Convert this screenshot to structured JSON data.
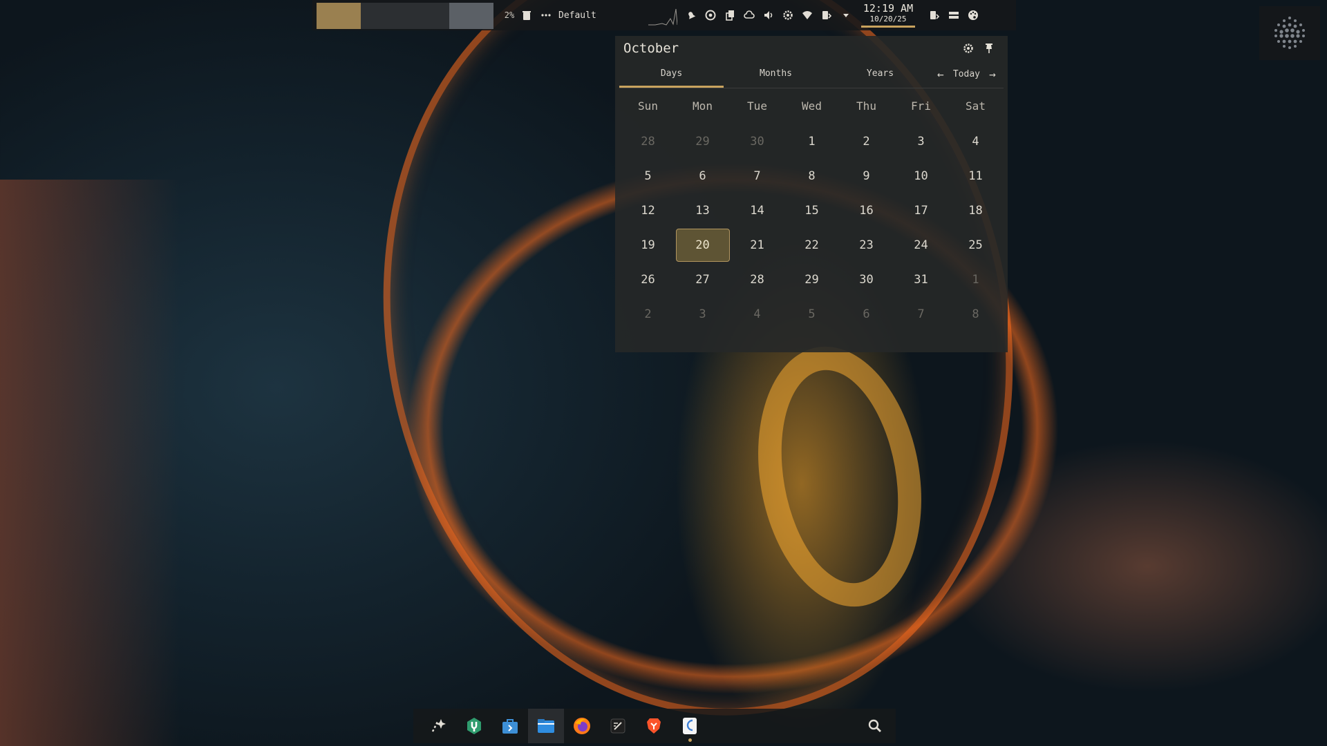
{
  "topbar": {
    "workspaces": [
      {
        "id": 1,
        "active": true
      },
      {
        "id": 2,
        "active": false
      },
      {
        "id": 3,
        "active": false
      },
      {
        "id": 4,
        "active": false
      }
    ],
    "cpu_usage": "2%",
    "power_profile": "Default",
    "clock": {
      "time": "12:19 AM",
      "date": "10/20/25"
    },
    "tray_icons": [
      "notification-bell-icon",
      "obs-icon",
      "clipboard-icon",
      "cloud-sync-icon",
      "volume-icon",
      "settings-gear-icon",
      "wifi-icon",
      "bluetooth-battery-icon",
      "chevron-down-icon"
    ],
    "right_icons": [
      "power-menu-icon",
      "wallpaper-icon",
      "theme-palette-icon"
    ]
  },
  "calendar": {
    "month_title": "October",
    "tabs": [
      "Days",
      "Months",
      "Years"
    ],
    "active_tab": "Days",
    "today_label": "Today",
    "weekdays": [
      "Sun",
      "Mon",
      "Tue",
      "Wed",
      "Thu",
      "Fri",
      "Sat"
    ],
    "weeks": [
      [
        "28",
        "29",
        "30",
        "1",
        "2",
        "3",
        "4"
      ],
      [
        "5",
        "6",
        "7",
        "8",
        "9",
        "10",
        "11"
      ],
      [
        "12",
        "13",
        "14",
        "15",
        "16",
        "17",
        "18"
      ],
      [
        "19",
        "20",
        "21",
        "22",
        "23",
        "24",
        "25"
      ],
      [
        "26",
        "27",
        "28",
        "29",
        "30",
        "31",
        "1"
      ],
      [
        "2",
        "3",
        "4",
        "5",
        "6",
        "7",
        "8"
      ]
    ],
    "today": "20"
  },
  "dock": {
    "apps": [
      {
        "name": "launcher",
        "icon": "sparkle-launcher-icon"
      },
      {
        "name": "tweaks",
        "icon": "wrench-icon"
      },
      {
        "name": "software-store",
        "icon": "store-bag-icon"
      },
      {
        "name": "files",
        "icon": "folder-icon"
      },
      {
        "name": "firefox",
        "icon": "firefox-icon"
      },
      {
        "name": "text-editor",
        "icon": "text-editor-icon"
      },
      {
        "name": "brave",
        "icon": "brave-icon"
      },
      {
        "name": "settings-app",
        "icon": "app-settings-icon"
      }
    ],
    "focused_app": "files",
    "running_app": "settings-app",
    "search_icon": "search-icon"
  },
  "colors": {
    "accent": "#c9a35e",
    "active_workspace": "#9a8050",
    "today_highlight": "#5e5434",
    "panel_bg": "#161819"
  }
}
